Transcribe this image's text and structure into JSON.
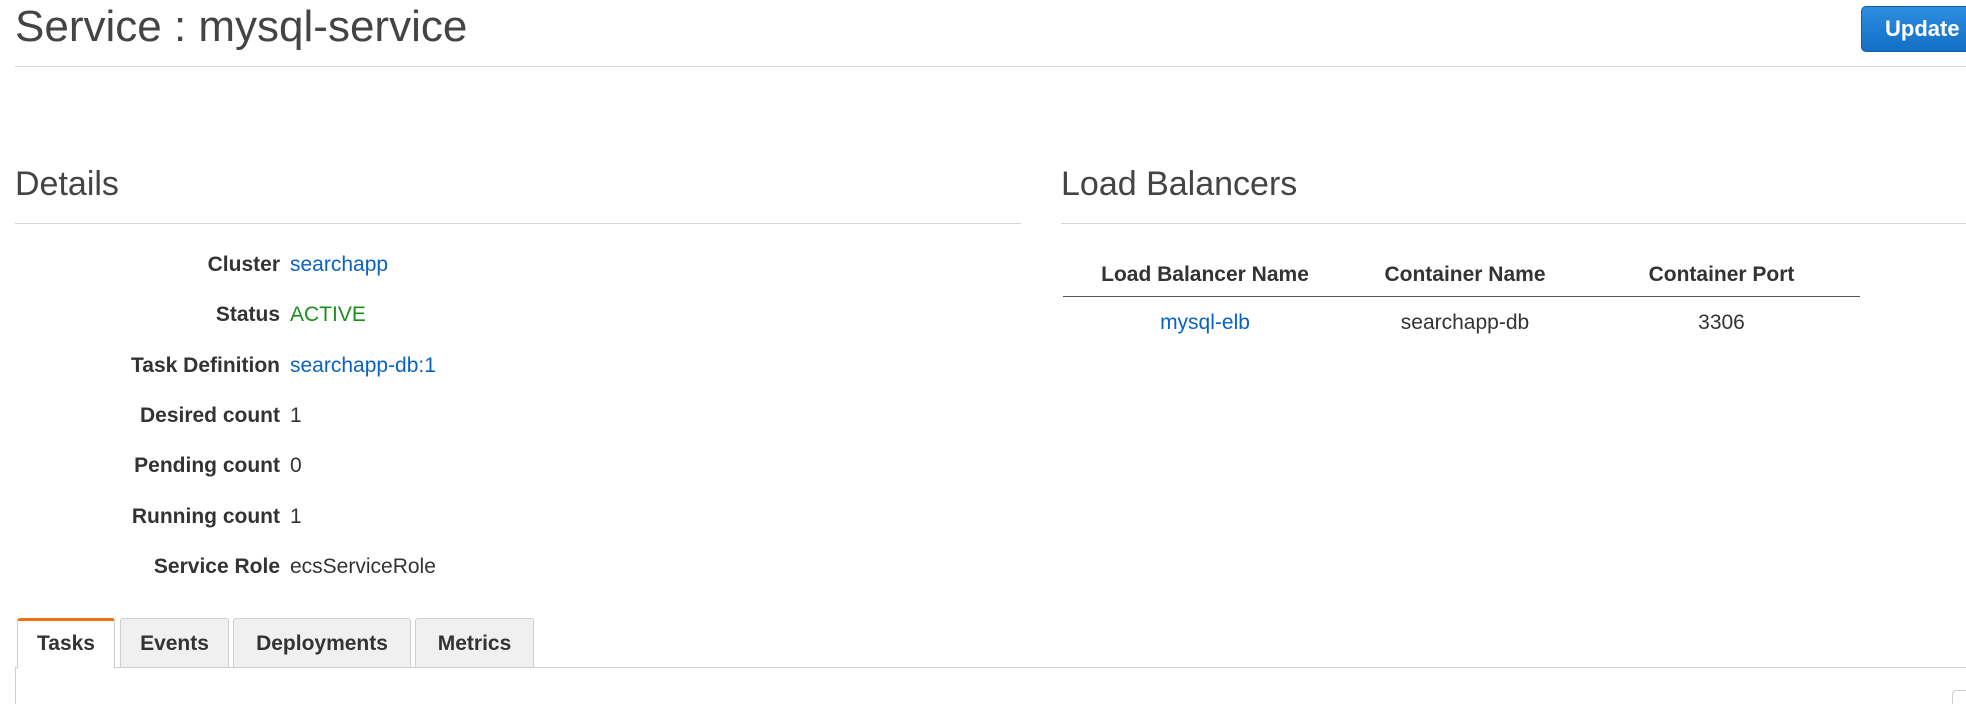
{
  "header": {
    "title": "Service : mysql-service",
    "update_label": "Update"
  },
  "details": {
    "heading": "Details",
    "rows": [
      {
        "label": "Cluster",
        "value": "searchapp"
      },
      {
        "label": "Status",
        "value": "ACTIVE"
      },
      {
        "label": "Task Definition",
        "value": "searchapp-db:1"
      },
      {
        "label": "Desired count",
        "value": "1"
      },
      {
        "label": "Pending count",
        "value": "0"
      },
      {
        "label": "Running count",
        "value": "1"
      },
      {
        "label": "Service Role",
        "value": "ecsServiceRole"
      }
    ]
  },
  "load_balancers": {
    "heading": "Load Balancers",
    "columns": [
      "Load Balancer Name",
      "Container Name",
      "Container Port"
    ],
    "rows": [
      [
        "mysql-elb",
        "searchapp-db",
        "3306"
      ]
    ]
  },
  "tabs": [
    {
      "label": "Tasks",
      "active": true
    },
    {
      "label": "Events",
      "active": false
    },
    {
      "label": "Deployments",
      "active": false
    },
    {
      "label": "Metrics",
      "active": false
    }
  ],
  "colors": {
    "link": "#0a62c2",
    "status_active": "#1d8f1d",
    "primary_button": "#1a73c9",
    "active_tab_accent": "#ec7211"
  }
}
